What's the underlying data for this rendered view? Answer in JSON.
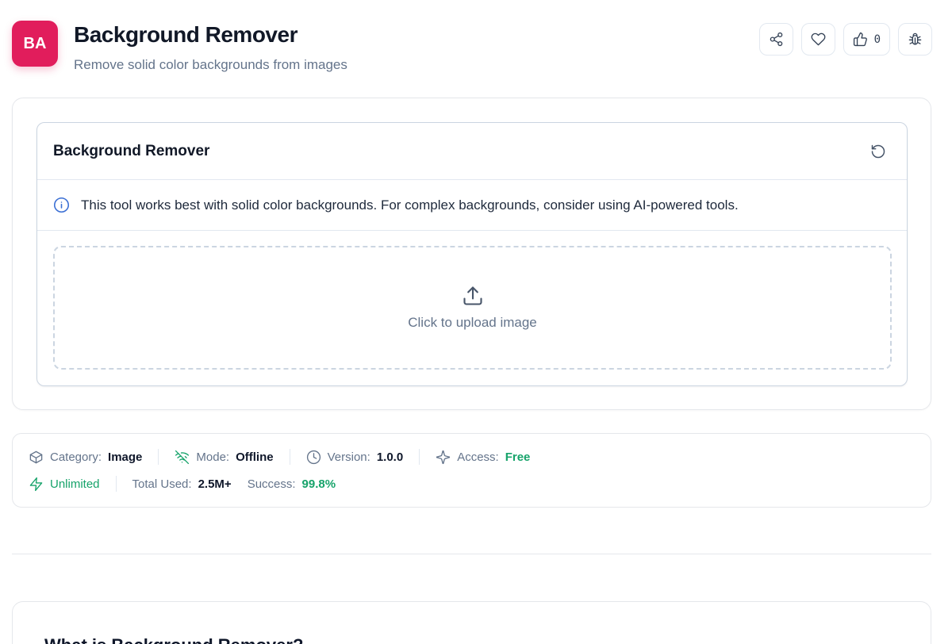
{
  "header": {
    "avatar_text": "BA",
    "title": "Background Remover",
    "subtitle": "Remove solid color backgrounds from images",
    "like_count": "0"
  },
  "tool": {
    "title": "Background Remover",
    "notice": "This tool works best with solid color backgrounds. For complex backgrounds, consider using AI-powered tools.",
    "upload_label": "Click to upload image"
  },
  "meta": {
    "category_key": "Category:",
    "category_val": "Image",
    "mode_key": "Mode:",
    "mode_val": "Offline",
    "version_key": "Version:",
    "version_val": "1.0.0",
    "access_key": "Access:",
    "access_val": "Free",
    "unlimited": "Unlimited",
    "total_key": "Total Used:",
    "total_val": "2.5M+",
    "success_key": "Success:",
    "success_val": "99.8%"
  },
  "about": {
    "title": "What is Background Remover?"
  },
  "colors": {
    "brand": "#e11d5c",
    "green": "#16a36a",
    "info": "#3b6fd4"
  },
  "icons": [
    "share-icon",
    "heart-icon",
    "thumbs-up-icon",
    "bug-icon",
    "reset-icon",
    "info-icon",
    "upload-icon",
    "box-icon",
    "wifi-off-icon",
    "clock-icon",
    "sparkles-icon",
    "zap-icon"
  ]
}
